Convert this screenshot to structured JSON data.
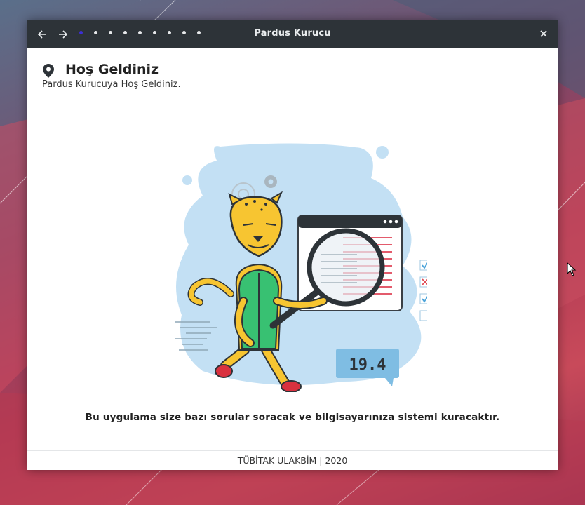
{
  "window": {
    "title": "Pardus Kurucu",
    "steps_total": 9,
    "current_step": 1
  },
  "header": {
    "icon": "map-marker-icon",
    "title": "Hoş Geldiniz",
    "subtitle": "Pardus Kurucuya Hoş Geldiniz."
  },
  "illustration": {
    "badge_value": "19.4"
  },
  "main": {
    "description": "Bu uygulama size bazı sorular soracak ve bilgisayarınıza sistemi kuracaktır."
  },
  "footer": {
    "text": "TÜBİTAK ULAKBİM | 2020"
  },
  "colors": {
    "titlebar": "#2d3338",
    "active_step": "#3d2fd6",
    "illustration_blob": "#c3e0f4",
    "accent_yellow": "#f7c531",
    "accent_green": "#38c172"
  }
}
